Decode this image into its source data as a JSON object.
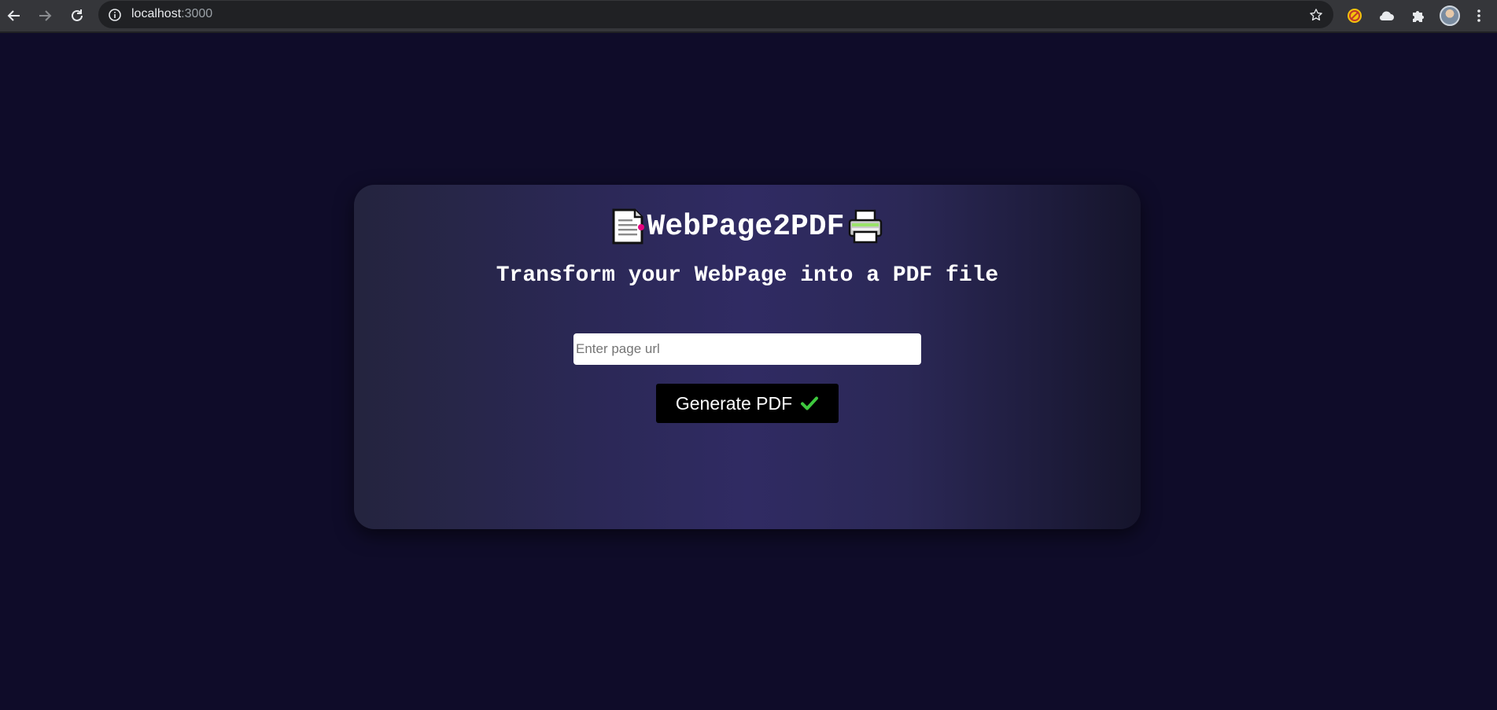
{
  "browser": {
    "url_host": "localhost",
    "url_port": ":3000"
  },
  "app": {
    "title": "WebPage2PDF",
    "subtitle": "Transform your WebPage into a PDF file",
    "url_input": {
      "placeholder": "Enter page url",
      "value": ""
    },
    "generate_button_label": "Generate PDF",
    "icons": [
      "page-facing-up-icon",
      "printer-icon",
      "check-mark-icon"
    ],
    "colors": {
      "background": "#0f0c29",
      "card_accent": "#302b63",
      "check": "#3ec93e"
    }
  }
}
